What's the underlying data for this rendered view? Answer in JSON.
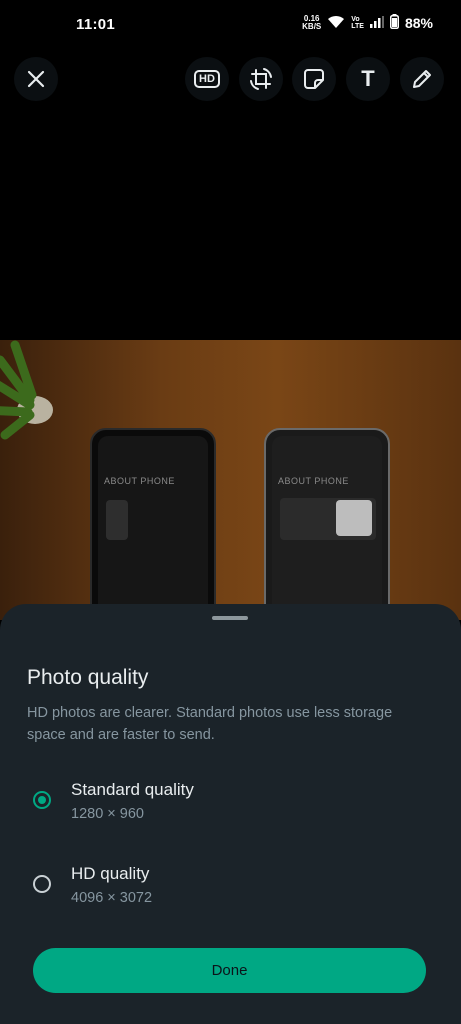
{
  "status_bar": {
    "time": "11:01",
    "net_speed_value": "0.16",
    "net_speed_unit": "KB/S",
    "volte_top": "Vo",
    "volte_bottom": "LTE",
    "battery": "88%"
  },
  "toolbar": {
    "hd_label": "HD",
    "text_label": "T"
  },
  "photo": {
    "left_phone_title": "ABOUT PHONE",
    "right_phone_title": "ABOUT PHONE"
  },
  "sheet": {
    "title": "Photo quality",
    "description": "HD photos are clearer. Standard photos use less storage space and are faster to send.",
    "options": [
      {
        "label": "Standard quality",
        "resolution": "1280 × 960",
        "selected": true
      },
      {
        "label": "HD quality",
        "resolution": "4096 × 3072",
        "selected": false
      }
    ],
    "done_label": "Done"
  },
  "colors": {
    "accent": "#00a884",
    "sheet_bg": "#1b2329",
    "primary_text": "#e9edef",
    "secondary_text": "#8696a0"
  }
}
